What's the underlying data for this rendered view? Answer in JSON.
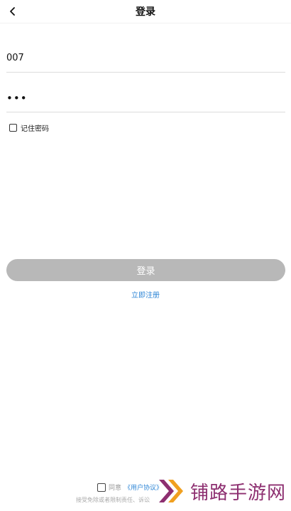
{
  "header": {
    "title": "登录",
    "back_icon": "chevron-left-icon"
  },
  "form": {
    "username_value": "007",
    "password_value": "•••",
    "remember_label": "记住密码"
  },
  "actions": {
    "login_label": "登录",
    "register_label": "立即注册",
    "login_button_color": "#b8b8b8",
    "link_color": "#2e86d6"
  },
  "agreement": {
    "agree_text": "同意",
    "agreement_link": "《用户协议》",
    "notice": "接受免除或者限制责任、诉讼"
  },
  "watermark": {
    "text": "铺路手游网",
    "color": "#8d2f70"
  }
}
